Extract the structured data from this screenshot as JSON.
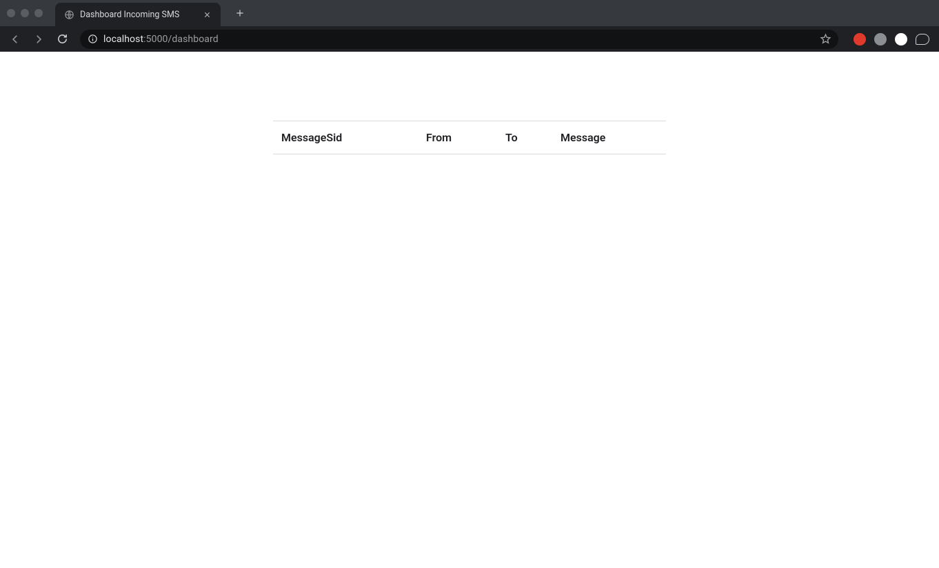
{
  "browser": {
    "tab_title": "Dashboard Incoming SMS",
    "url_host": "localhost",
    "url_rest": ":5000/dashboard"
  },
  "table": {
    "headers": [
      "MessageSid",
      "From",
      "To",
      "Message"
    ]
  }
}
